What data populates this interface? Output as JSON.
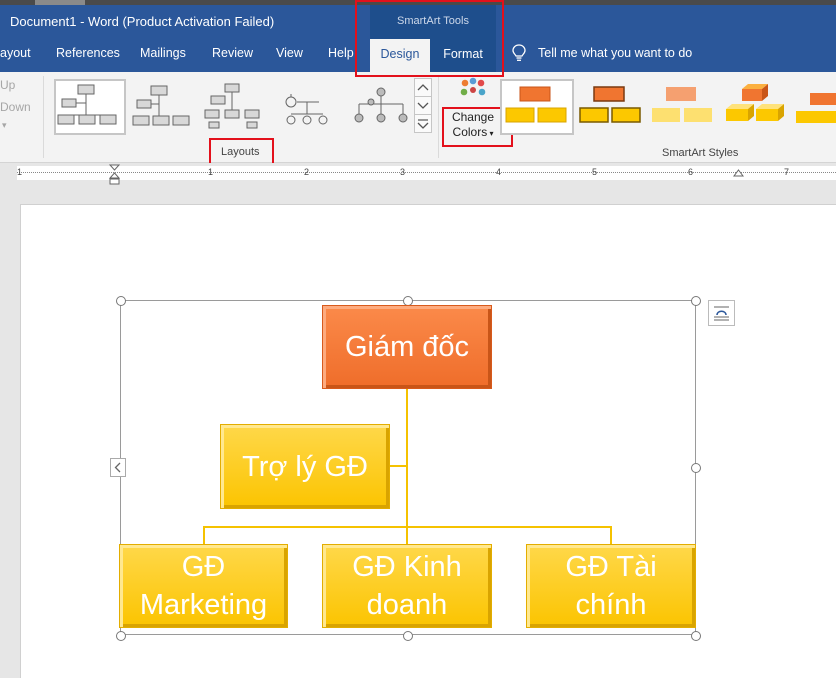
{
  "window": {
    "title": "Document1  -  Word (Product Activation Failed)"
  },
  "contextual_tab_group": {
    "label": "SmartArt Tools"
  },
  "tabs": [
    {
      "label": "ayout"
    },
    {
      "label": "References"
    },
    {
      "label": "Mailings"
    },
    {
      "label": "Review"
    },
    {
      "label": "View"
    },
    {
      "label": "Help"
    },
    {
      "label": "Design",
      "selected": true
    },
    {
      "label": "Format"
    }
  ],
  "tell_me": {
    "placeholder": "Tell me what you want to do"
  },
  "ribbon": {
    "move_up_label": "Up",
    "move_down_label": "Down",
    "layouts_group_label": "Layouts",
    "change_colors_line1": "Change",
    "change_colors_line2": "Colors",
    "smartart_styles_group_label": "SmartArt Styles"
  },
  "ruler": {
    "numbers": [
      "1",
      "1",
      "2",
      "3",
      "4",
      "5",
      "6",
      "7"
    ]
  },
  "smartart": {
    "top": "Giám đốc",
    "assistant": "Trợ lý GĐ",
    "children": [
      "GĐ Marketing",
      "GĐ Kinh doanh",
      "GĐ Tài chính"
    ]
  },
  "colors": {
    "ribbon_blue": "#2b579a",
    "highlight_red": "#e3101b",
    "orange_shape": "#f07530",
    "yellow_shape": "#fcc800"
  }
}
